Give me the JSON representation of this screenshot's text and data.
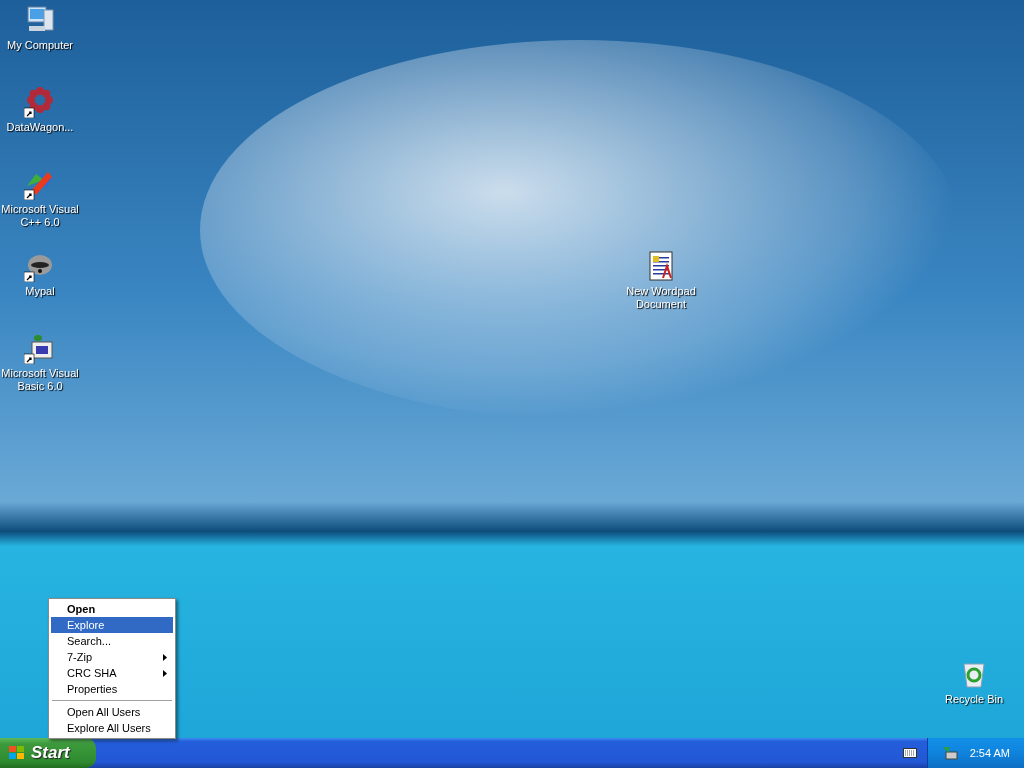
{
  "desktop_icons": [
    {
      "kind": "computer",
      "label": "My Computer",
      "shortcut": false
    },
    {
      "kind": "flower",
      "label": "DataWagon...",
      "shortcut": true
    },
    {
      "kind": "cpp",
      "label": "Microsoft Visual C++ 6.0",
      "shortcut": true
    },
    {
      "kind": "raccoon",
      "label": "Mypal",
      "shortcut": true
    },
    {
      "kind": "vb",
      "label": "Microsoft Visual Basic 6.0",
      "shortcut": true
    },
    {
      "kind": "document",
      "label": "New Wordpad Document",
      "shortcut": false
    },
    {
      "kind": "recycle",
      "label": "Recycle Bin",
      "shortcut": false
    }
  ],
  "context_menu": [
    {
      "kind": "item",
      "label": "Open",
      "default": true,
      "selected": false,
      "submenu": false
    },
    {
      "kind": "item",
      "label": "Explore",
      "default": false,
      "selected": true,
      "submenu": false
    },
    {
      "kind": "item",
      "label": "Search...",
      "default": false,
      "selected": false,
      "submenu": false
    },
    {
      "kind": "item",
      "label": "7-Zip",
      "default": false,
      "selected": false,
      "submenu": true
    },
    {
      "kind": "item",
      "label": "CRC SHA",
      "default": false,
      "selected": false,
      "submenu": true
    },
    {
      "kind": "item",
      "label": "Properties",
      "default": false,
      "selected": false,
      "submenu": false
    },
    {
      "kind": "separator"
    },
    {
      "kind": "item",
      "label": "Open All Users",
      "default": false,
      "selected": false,
      "submenu": false
    },
    {
      "kind": "item",
      "label": "Explore All Users",
      "default": false,
      "selected": false,
      "submenu": false
    }
  ],
  "taskbar": {
    "start_label": "Start",
    "clock": "2:54 AM"
  }
}
